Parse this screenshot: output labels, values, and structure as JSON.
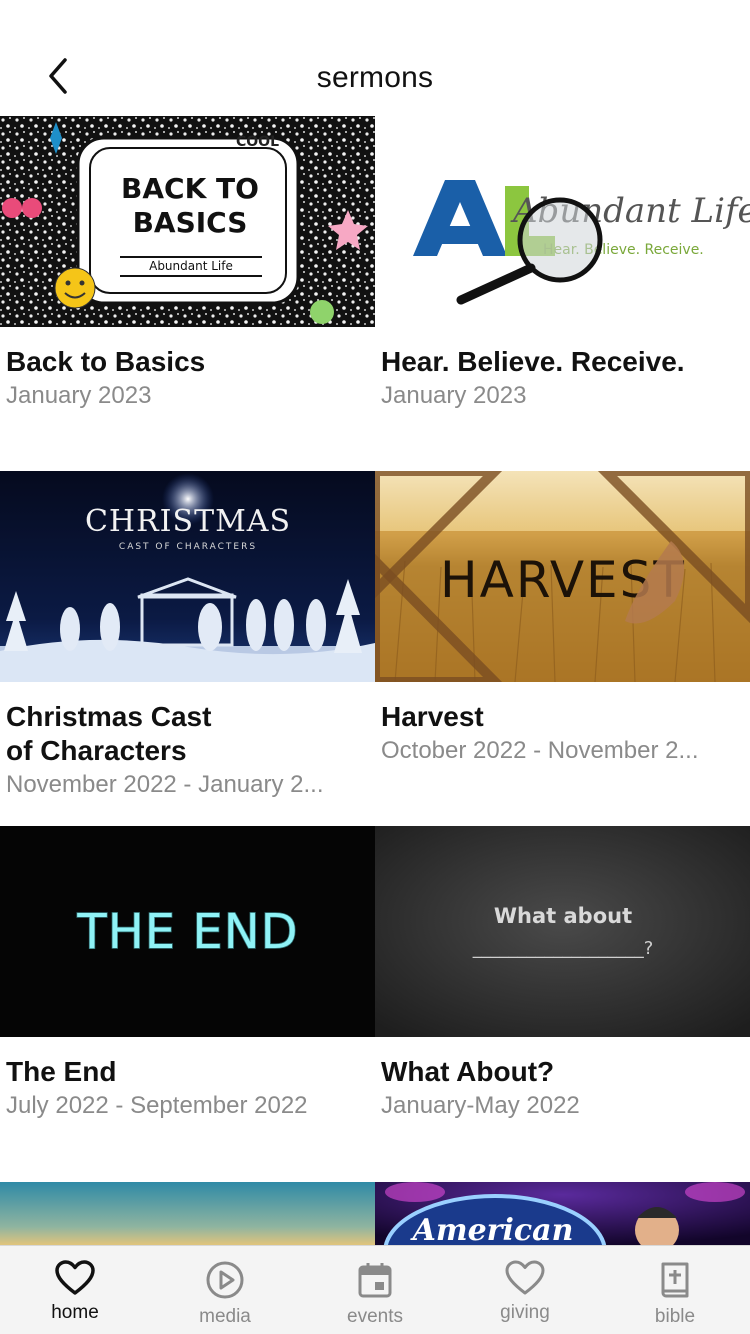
{
  "nav": {
    "title": "sermons",
    "back_icon": "chevron-left-icon"
  },
  "sermons": [
    {
      "title": "Back to Basics",
      "date": "January 2023",
      "thumb_text": [
        "BACK TO",
        "BASICS",
        "Abundant Life",
        "COOL"
      ]
    },
    {
      "title": "Hear. Believe. Receive.",
      "date": "January 2023",
      "thumb_text": [
        "AL",
        "Abundant Life",
        "Hear. Believe. Receive."
      ]
    },
    {
      "title": "Christmas Cast\nof Characters",
      "date": "November 2022 - January 2...",
      "thumb_text": [
        "CHRISTMAS",
        "CAST OF CHARACTERS"
      ]
    },
    {
      "title": "Harvest",
      "date": "October 2022 - November 2...",
      "thumb_text": [
        "HARVEST"
      ]
    },
    {
      "title": "The End",
      "date": "July 2022 - September 2022",
      "thumb_text": [
        "THE END"
      ]
    },
    {
      "title": "What About?",
      "date": "January-May 2022",
      "thumb_text": [
        "What about",
        "___________________?"
      ]
    }
  ],
  "partial": {
    "thumb_text": "American"
  },
  "tabs": [
    {
      "label": "home",
      "icon": "heart-icon",
      "active": true
    },
    {
      "label": "media",
      "icon": "play-circle-icon",
      "active": false
    },
    {
      "label": "events",
      "icon": "calendar-icon",
      "active": false
    },
    {
      "label": "giving",
      "icon": "heart-outline-icon",
      "active": false
    },
    {
      "label": "bible",
      "icon": "bible-icon",
      "active": false
    }
  ],
  "colors": {
    "tab_active": "#111111",
    "tab_inactive": "#8a8a8a",
    "date_gray": "#8a8a8a",
    "tabbar_bg": "#f4f4f4"
  }
}
